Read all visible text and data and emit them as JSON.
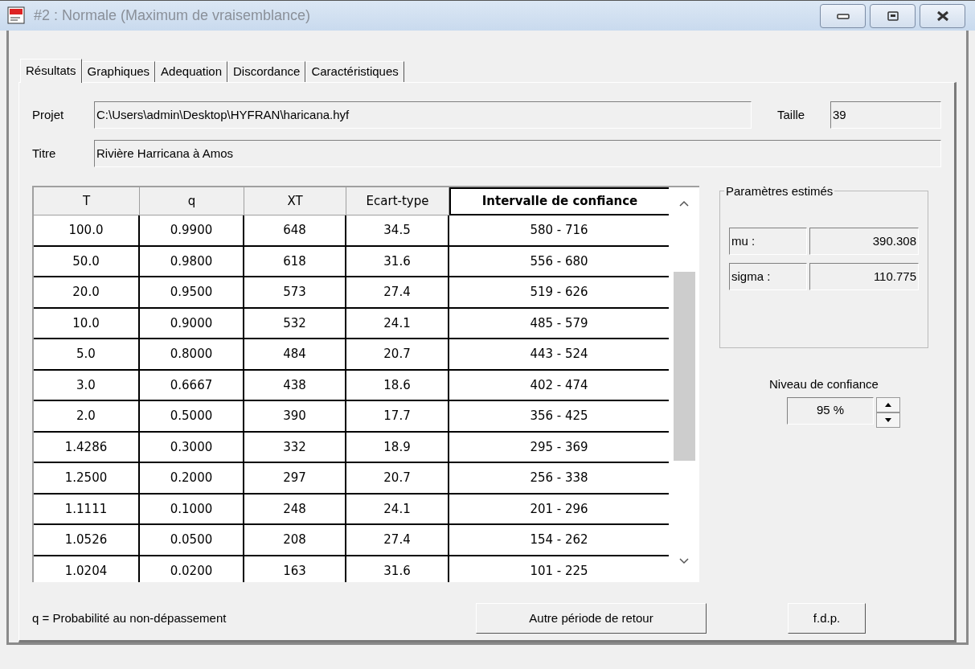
{
  "window": {
    "title": "#2 : Normale (Maximum de vraisemblance)"
  },
  "tabs": [
    {
      "label": "Résultats",
      "selected": true
    },
    {
      "label": "Graphiques",
      "selected": false
    },
    {
      "label": "Adequation",
      "selected": false
    },
    {
      "label": "Discordance",
      "selected": false
    },
    {
      "label": "Caractéristiques",
      "selected": false
    }
  ],
  "project": {
    "label": "Projet",
    "value": "C:\\Users\\admin\\Desktop\\HYFRAN\\haricana.hyf"
  },
  "size": {
    "label": "Taille",
    "value": "39"
  },
  "title_field": {
    "label": "Titre",
    "value": "Rivière Harricana à Amos"
  },
  "table": {
    "columns": [
      {
        "label": "T",
        "selected": false
      },
      {
        "label": "q",
        "selected": false
      },
      {
        "label": "XT",
        "selected": false
      },
      {
        "label": "Ecart-type",
        "selected": false
      },
      {
        "label": "Intervalle de confiance",
        "selected": true
      }
    ],
    "rows": [
      [
        "100.0",
        "0.9900",
        "648",
        "34.5",
        "580 - 716"
      ],
      [
        "50.0",
        "0.9800",
        "618",
        "31.6",
        "556 - 680"
      ],
      [
        "20.0",
        "0.9500",
        "573",
        "27.4",
        "519 - 626"
      ],
      [
        "10.0",
        "0.9000",
        "532",
        "24.1",
        "485 - 579"
      ],
      [
        "5.0",
        "0.8000",
        "484",
        "20.7",
        "443 - 524"
      ],
      [
        "3.0",
        "0.6667",
        "438",
        "18.6",
        "402 - 474"
      ],
      [
        "2.0",
        "0.5000",
        "390",
        "17.7",
        "356 - 425"
      ],
      [
        "1.4286",
        "0.3000",
        "332",
        "18.9",
        "295 - 369"
      ],
      [
        "1.2500",
        "0.2000",
        "297",
        "20.7",
        "256 - 338"
      ],
      [
        "1.1111",
        "0.1000",
        "248",
        "24.1",
        "201 - 296"
      ],
      [
        "1.0526",
        "0.0500",
        "208",
        "27.4",
        "154 - 262"
      ],
      [
        "1.0204",
        "0.0200",
        "163",
        "31.6",
        "101 - 225"
      ]
    ]
  },
  "parameters": {
    "title": "Paramètres estimés",
    "items": [
      {
        "name": "mu :",
        "value": "390.308"
      },
      {
        "name": "sigma :",
        "value": "110.775"
      }
    ]
  },
  "confidence": {
    "label": "Niveau de confiance",
    "value": "95 %"
  },
  "footnote": "q = Probabilité au non-dépassement",
  "buttons": [
    "Autre période de retour",
    "f.d.p."
  ]
}
